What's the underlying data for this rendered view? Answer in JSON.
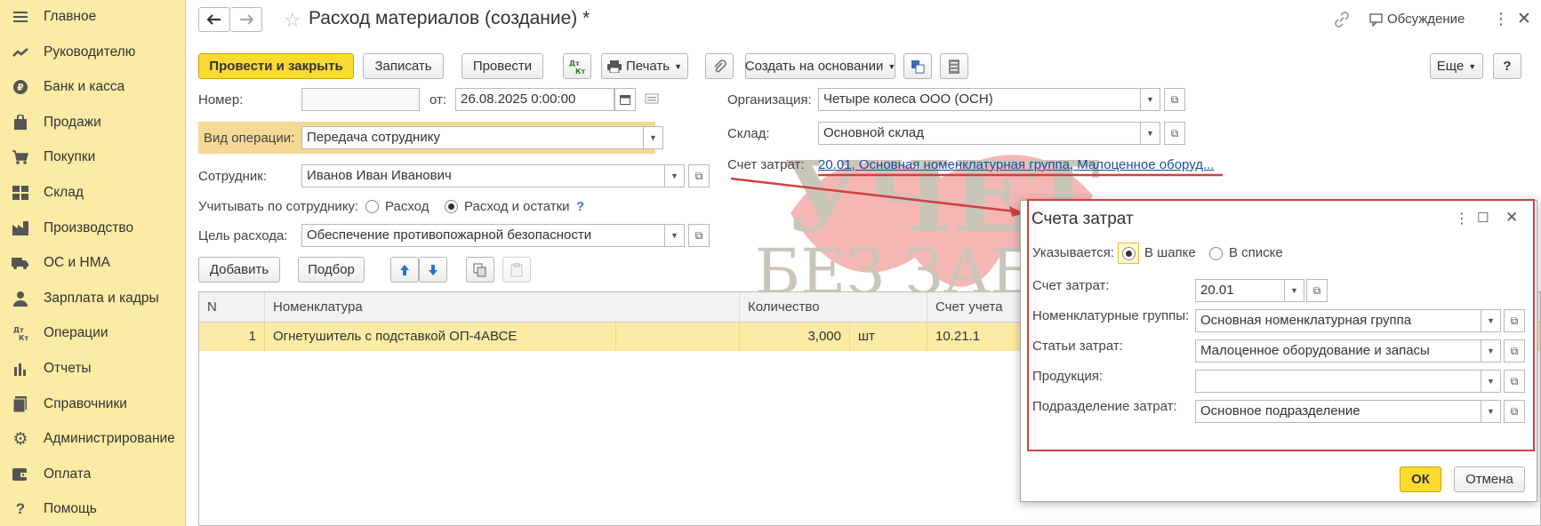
{
  "sidebar": {
    "items": [
      {
        "label": "Главное",
        "icon": "menu-icon"
      },
      {
        "label": "Руководителю",
        "icon": "trend-icon"
      },
      {
        "label": "Банк и касса",
        "icon": "ruble-icon"
      },
      {
        "label": "Продажи",
        "icon": "bag-icon"
      },
      {
        "label": "Покупки",
        "icon": "cart-icon"
      },
      {
        "label": "Склад",
        "icon": "warehouse-icon"
      },
      {
        "label": "Производство",
        "icon": "factory-icon"
      },
      {
        "label": "ОС и НМА",
        "icon": "truck-icon"
      },
      {
        "label": "Зарплата и кадры",
        "icon": "person-icon"
      },
      {
        "label": "Операции",
        "icon": "dtkt-icon"
      },
      {
        "label": "Отчеты",
        "icon": "bar-chart-icon"
      },
      {
        "label": "Справочники",
        "icon": "book-icon"
      },
      {
        "label": "Администрирование",
        "icon": "gear-icon"
      },
      {
        "label": "Оплата",
        "icon": "wallet-icon"
      },
      {
        "label": "Помощь",
        "icon": "question-icon"
      }
    ]
  },
  "header": {
    "title": "Расход материалов (создание) *",
    "discussion": "Обсуждение"
  },
  "toolbar": {
    "post_close": "Провести и закрыть",
    "save": "Записать",
    "post": "Провести",
    "dtkt": "Дт\nКт",
    "print": "Печать",
    "create_based": "Создать на основании",
    "more": "Еще",
    "help": "?"
  },
  "form": {
    "number_label": "Номер:",
    "number_value": "",
    "from_label": "от:",
    "date_value": "26.08.2025  0:00:00",
    "org_label": "Организация:",
    "org_value": "Четыре колеса ООО (ОСН)",
    "op_label": "Вид операции:",
    "op_value": "Передача сотруднику",
    "warehouse_label": "Склад:",
    "warehouse_value": "Основной склад",
    "employee_label": "Сотрудник:",
    "employee_value": "Иванов Иван Иванович",
    "cost_account_label": "Счет затрат:",
    "cost_account_link": "20.01, Основная номенклатурная группа, Малоценное оборуд...",
    "track_label": "Учитывать по сотруднику:",
    "track_opt1": "Расход",
    "track_opt2": "Расход и остатки",
    "track_help": "?",
    "purpose_label": "Цель расхода:",
    "purpose_value": "Обеспечение противопожарной безопасности"
  },
  "table_toolbar": {
    "add": "Добавить",
    "pick": "Подбор"
  },
  "table": {
    "headers": [
      "N",
      "Номенклатура",
      "Количество",
      "Счет учета"
    ],
    "rows": [
      {
        "n": "1",
        "item": "Огнетушитель с подставкой ОП-4АВСЕ",
        "qty": "3,000",
        "unit": "шт",
        "account": "10.21.1"
      }
    ]
  },
  "watermark": {
    "line1": "УЧЕТ",
    "line2": "БЕЗ ЗАБОТ"
  },
  "dialog": {
    "title": "Счета затрат",
    "specified_label": "Указывается:",
    "opt_header": "В шапке",
    "opt_list": "В списке",
    "cost_account_label": "Счет затрат:",
    "cost_account_value": "20.01",
    "nom_groups_label": "Номенклатурные группы:",
    "nom_groups_value": "Основная номенклатурная группа",
    "cost_items_label": "Статьи затрат:",
    "cost_items_value": "Малоценное оборудование и запасы",
    "product_label": "Продукция:",
    "product_value": "",
    "division_label": "Подразделение затрат:",
    "division_value": "Основное подразделение",
    "ok": "ОК",
    "cancel": "Отмена"
  },
  "colors": {
    "sidebar_bg": "#fbeba4",
    "primary_button": "#fbdb30",
    "highlight_red": "#d04040",
    "link": "#1a4fa0"
  }
}
